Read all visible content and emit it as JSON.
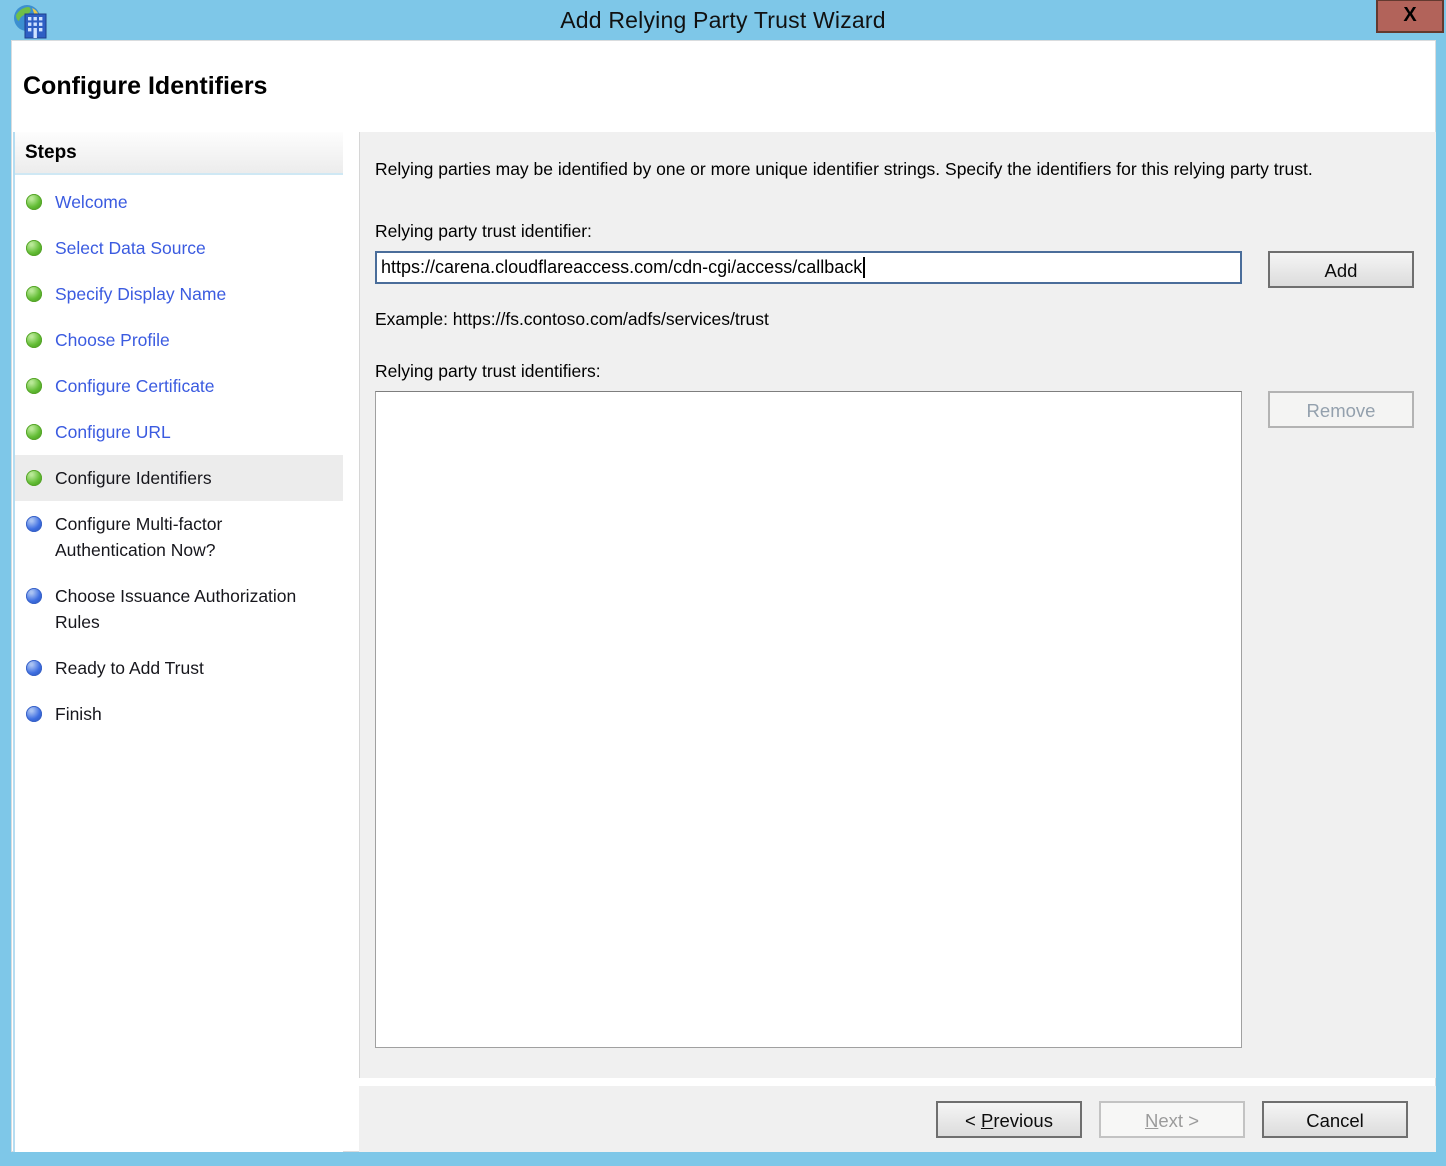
{
  "window": {
    "title": "Add Relying Party Trust Wizard",
    "close_label": "X"
  },
  "page": {
    "heading": "Configure Identifiers"
  },
  "sidebar": {
    "heading": "Steps",
    "items": [
      {
        "label": "Welcome",
        "state": "done"
      },
      {
        "label": "Select Data Source",
        "state": "done"
      },
      {
        "label": "Specify Display Name",
        "state": "done"
      },
      {
        "label": "Choose Profile",
        "state": "done"
      },
      {
        "label": "Configure Certificate",
        "state": "done"
      },
      {
        "label": "Configure URL",
        "state": "done"
      },
      {
        "label": "Configure Identifiers",
        "state": "current"
      },
      {
        "label": "Configure Multi-factor Authentication Now?",
        "state": "upcoming"
      },
      {
        "label": "Choose Issuance Authorization Rules",
        "state": "upcoming"
      },
      {
        "label": "Ready to Add Trust",
        "state": "upcoming"
      },
      {
        "label": "Finish",
        "state": "upcoming"
      }
    ]
  },
  "main": {
    "description": "Relying parties may be identified by one or more unique identifier strings. Specify the identifiers for this relying party trust.",
    "identifier_label": "Relying party trust identifier:",
    "identifier_value": "https://carena.cloudflareaccess.com/cdn-cgi/access/callback",
    "add_button": "Add",
    "example": "Example: https://fs.contoso.com/adfs/services/trust",
    "identifiers_label": "Relying party trust identifiers:",
    "identifiers_list": [],
    "remove_button": "Remove",
    "remove_enabled": false
  },
  "footer": {
    "buttons": [
      {
        "id": "previous",
        "label": "< Previous",
        "accesskey": "P",
        "enabled": true
      },
      {
        "id": "next",
        "label": "Next >",
        "accesskey": "N",
        "enabled": false
      },
      {
        "id": "cancel",
        "label": "Cancel",
        "accesskey": "",
        "enabled": true
      }
    ]
  },
  "colors": {
    "titlebar_blue": "#7ec7e8",
    "close_button_red": "#b2635a",
    "link_blue": "#3b5be0",
    "done_dot_green": "#63bd35",
    "upcoming_dot_blue": "#3f6fe2",
    "panel_gray": "#f0f0f0",
    "current_step_highlight": "#ececec"
  }
}
